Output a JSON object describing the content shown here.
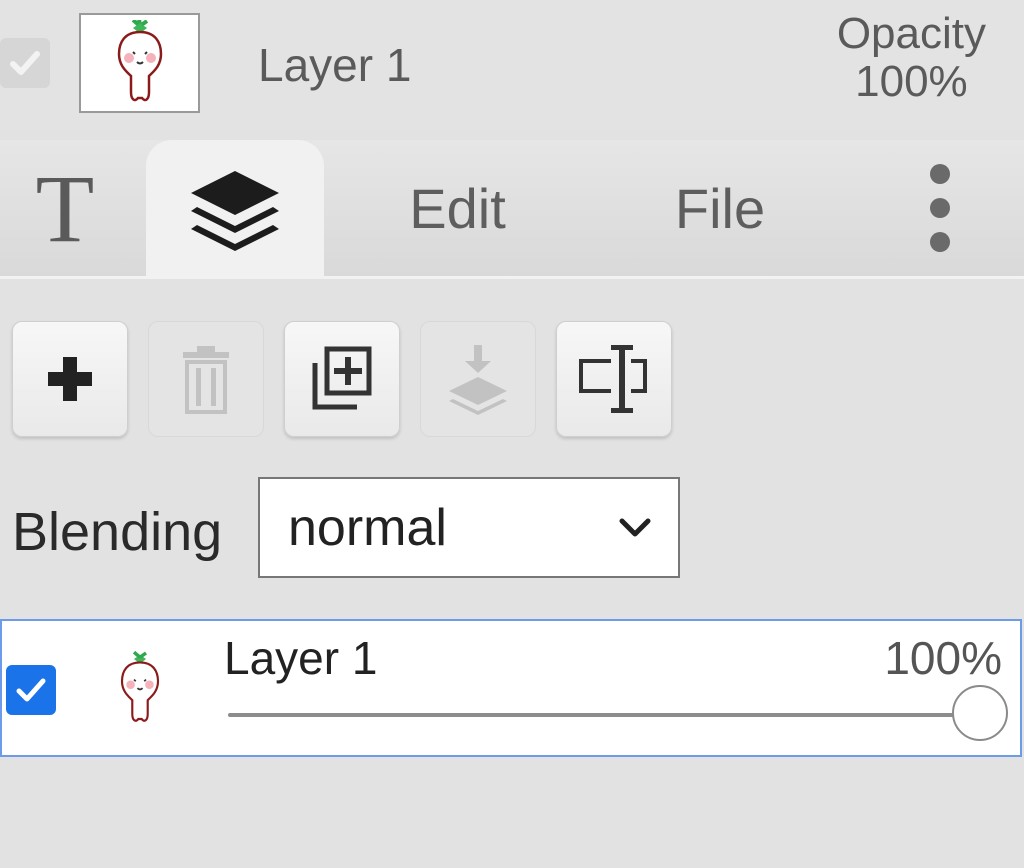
{
  "top": {
    "layer_name": "Layer 1",
    "opacity_label": "Opacity",
    "opacity_value": "100%"
  },
  "tabs": {
    "text_glyph": "T",
    "layers_icon": "layers-icon",
    "edit_label": "Edit",
    "file_label": "File",
    "more_icon": "vertical-ellipsis-icon"
  },
  "toolbar": {
    "buttons": [
      {
        "icon": "add-icon",
        "enabled": true
      },
      {
        "icon": "trash-icon",
        "enabled": false
      },
      {
        "icon": "duplicate-icon",
        "enabled": true
      },
      {
        "icon": "merge-down-icon",
        "enabled": false
      },
      {
        "icon": "rename-icon",
        "enabled": true
      }
    ]
  },
  "blending": {
    "label": "Blending",
    "value": "normal"
  },
  "layers": [
    {
      "name": "Layer 1",
      "opacity": "100%",
      "opacity_fraction": 1.0,
      "visible": true
    }
  ],
  "colors": {
    "accent": "#1a73e8",
    "selected_border": "#6b9bea"
  }
}
